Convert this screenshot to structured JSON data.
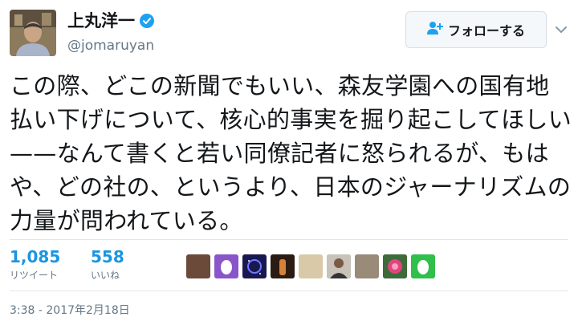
{
  "tweet": {
    "display_name": "上丸洋一",
    "handle": "@jomaruyan",
    "follow_label": "フォローする",
    "text": "この際、どこの新聞でもいい、森友学園への国有地払い下げについて、核心的事実を掘り起こしてほしい——なんて書くと若い同僚記者に怒られるが、もはや、どの社の、というより、日本のジャーナリズムの力量が問われている。",
    "timestamp": "3:38 - 2017年2月18日"
  },
  "stats": {
    "retweets": {
      "count": "1,085",
      "label": "リツイート"
    },
    "likes": {
      "count": "558",
      "label": "いいね"
    }
  },
  "likers": [
    {
      "icon": "liker-photo-icon",
      "color": "#6b4a3a"
    },
    {
      "icon": "egg-icon",
      "color": "#8a55c9"
    },
    {
      "icon": "night-sky-icon",
      "color": "#1a1850"
    },
    {
      "icon": "figure-photo-icon",
      "color": "#c0642a"
    },
    {
      "icon": "liker-photo-icon",
      "color": "#d9c9a8"
    },
    {
      "icon": "person-photo-icon",
      "color": "#5b5b5b"
    },
    {
      "icon": "cat-photo-icon",
      "color": "#9a8a78"
    },
    {
      "icon": "flower-photo-icon",
      "color": "#c7346a"
    },
    {
      "icon": "egg-icon",
      "color": "#2fbf4a"
    }
  ],
  "colors": {
    "accent": "#1da1f2",
    "stat_number": "#1b95e0",
    "secondary_text": "#657786",
    "divider": "#e1e8ed"
  }
}
